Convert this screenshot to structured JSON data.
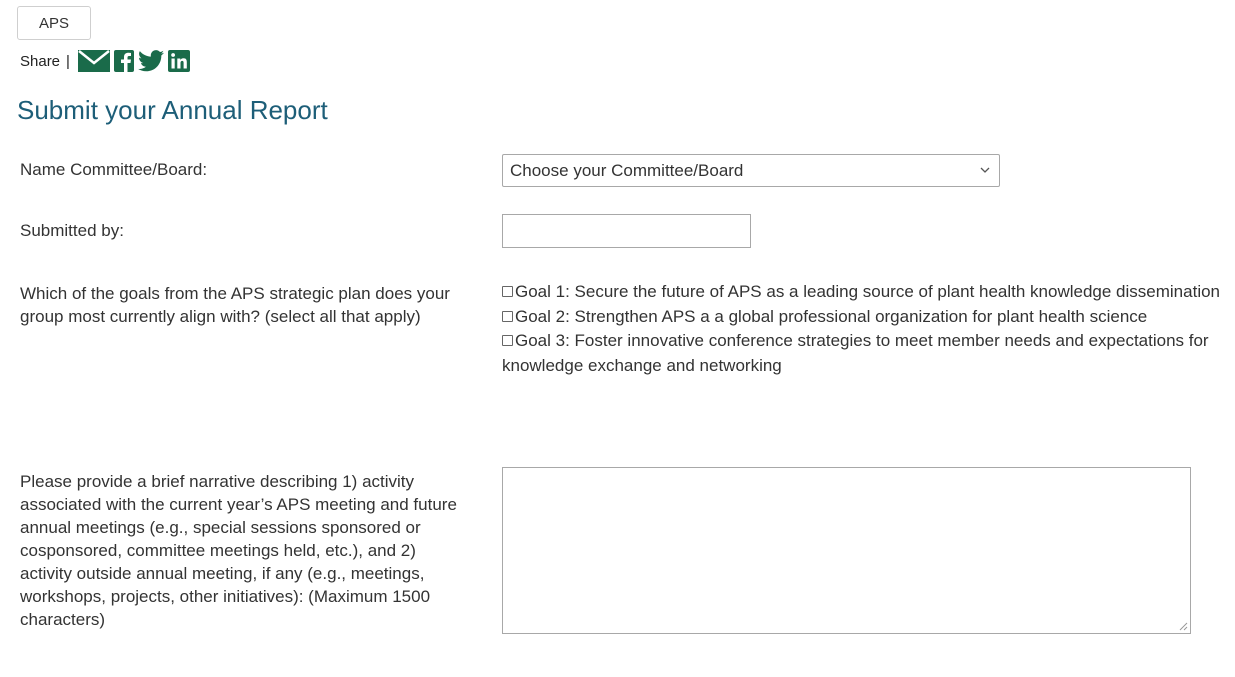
{
  "header": {
    "tag_button": "APS",
    "share_label": "Share",
    "share_separator": "|",
    "share_icons": [
      "email-icon",
      "facebook-icon",
      "twitter-icon",
      "linkedin-icon"
    ],
    "share_icon_color": "#1a6b4a"
  },
  "form": {
    "title": "Submit your Annual Report",
    "title_color": "#1d5e78",
    "committee": {
      "label": "Name Committee/Board:",
      "selected": "Choose your Committee/Board"
    },
    "submitted_by": {
      "label": "Submitted by:",
      "value": ""
    },
    "goals": {
      "label": "Which of the goals from the APS strategic plan does your group most currently align with? (select all that apply)",
      "options": [
        {
          "label": "Goal 1: Secure the future of APS as a leading source of plant health knowledge dissemination",
          "checked": false
        },
        {
          "label": "Goal 2: Strengthen APS a a global professional organization for plant health science",
          "checked": false
        },
        {
          "label": "Goal 3: Foster innovative conference strategies to meet member needs and expectations for knowledge exchange and networking",
          "checked": false
        }
      ]
    },
    "narrative": {
      "label": "Please provide a brief narrative describing 1) activity associated with the current year’s APS meeting and future annual meetings (e.g., special sessions sponsored or cosponsored, committee meetings held, etc.), and 2) activity outside annual meeting, if any (e.g., meetings, workshops, projects, other initiatives): (Maximum 1500 characters)",
      "value": ""
    }
  }
}
